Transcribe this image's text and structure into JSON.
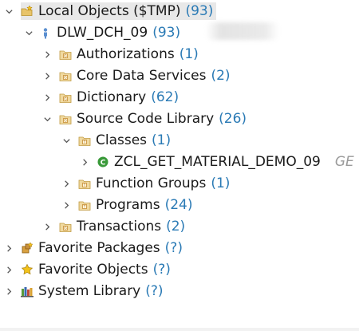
{
  "tree": {
    "nodes": [
      {
        "id": "local-objects",
        "label": "Local Objects ($TMP)",
        "count": "(93)",
        "expanded": true,
        "icon": "folder-star-icon",
        "level": 0
      },
      {
        "id": "dlw-dch-09",
        "label": "DLW_DCH_09",
        "count": "(93)",
        "expanded": true,
        "icon": "user-icon",
        "level": 1
      },
      {
        "id": "authorizations",
        "label": "Authorizations",
        "count": "(1)",
        "expanded": false,
        "icon": "package-folder-icon",
        "level": 2
      },
      {
        "id": "core-data-services",
        "label": "Core Data Services",
        "count": "(2)",
        "expanded": false,
        "icon": "package-folder-icon",
        "level": 2
      },
      {
        "id": "dictionary",
        "label": "Dictionary",
        "count": "(62)",
        "expanded": false,
        "icon": "package-folder-icon",
        "level": 2
      },
      {
        "id": "source-code-library",
        "label": "Source Code Library",
        "count": "(26)",
        "expanded": true,
        "icon": "package-folder-icon",
        "level": 2
      },
      {
        "id": "classes",
        "label": "Classes",
        "count": "(1)",
        "expanded": true,
        "icon": "type-folder-icon",
        "level": 3
      },
      {
        "id": "zcl-get-material-demo-09",
        "label": "ZCL_GET_MATERIAL_DEMO_09",
        "count": "",
        "suffix": "GE",
        "expanded": false,
        "icon": "class-icon",
        "level": 4
      },
      {
        "id": "function-groups",
        "label": "Function Groups",
        "count": "(1)",
        "expanded": false,
        "icon": "type-folder-icon",
        "level": 3
      },
      {
        "id": "programs",
        "label": "Programs",
        "count": "(24)",
        "expanded": false,
        "icon": "type-folder-icon",
        "level": 3
      },
      {
        "id": "transactions",
        "label": "Transactions",
        "count": "(2)",
        "expanded": false,
        "icon": "package-folder-icon",
        "level": 2
      },
      {
        "id": "favorite-packages",
        "label": "Favorite Packages",
        "count": "(?)",
        "expanded": false,
        "icon": "favorite-packages-icon",
        "level": 0
      },
      {
        "id": "favorite-objects",
        "label": "Favorite Objects",
        "count": "(?)",
        "expanded": false,
        "icon": "star-icon",
        "level": 0
      },
      {
        "id": "system-library",
        "label": "System Library",
        "count": "(?)",
        "expanded": false,
        "icon": "library-icon",
        "level": 0
      }
    ]
  },
  "colors": {
    "count": "#2a7ab5",
    "folder": "#e8b24a",
    "class": "#3a9a3a"
  }
}
